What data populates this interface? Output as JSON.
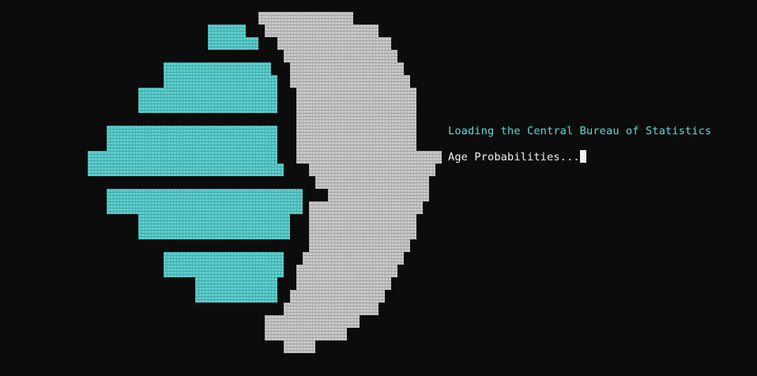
{
  "terminal": {
    "background_color": "#0c0c0c",
    "loading_text": "Loading the Central Bureau of Statistics",
    "loading_color": "#61d6d6",
    "progress_text": "Age Probabilities...",
    "progress_color": "#f2f2f2",
    "cursor_color": "#f2f2f2"
  },
  "logo": {
    "name": "cbs-logo",
    "teal_color": "#61d6d6",
    "gray_color": "#c8c8c8"
  }
}
